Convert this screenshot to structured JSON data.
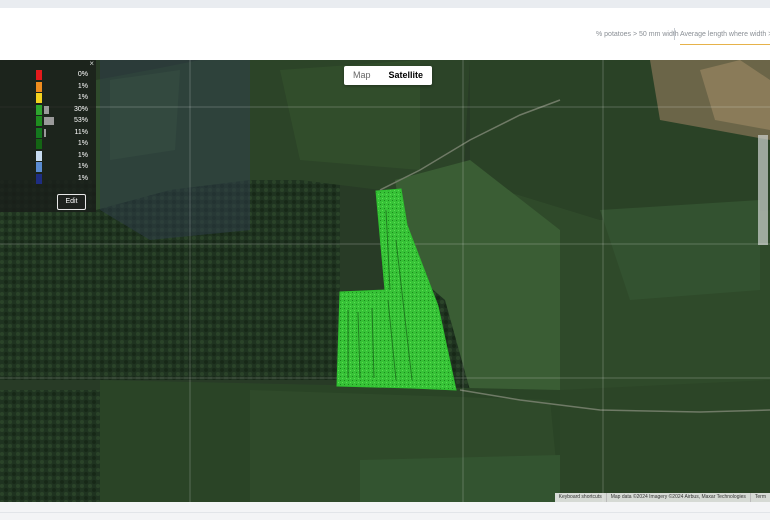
{
  "header": {
    "tabs": [
      {
        "label": "% potatoes > 50 mm width"
      },
      {
        "label": "Average length where width > 50 m"
      }
    ]
  },
  "map": {
    "type_control": {
      "map_label": "Map",
      "satellite_label": "Satellite",
      "selected": "Satellite"
    },
    "legend": {
      "close_symbol": "×",
      "rows": [
        {
          "color": "#e31a1c",
          "pct": "0%",
          "share": 0
        },
        {
          "color": "#f08c1e",
          "pct": "1%",
          "share": 1
        },
        {
          "color": "#f5d21e",
          "pct": "1%",
          "share": 1
        },
        {
          "color": "#2ea62e",
          "pct": "30%",
          "share": 30
        },
        {
          "color": "#1e8c1e",
          "pct": "53%",
          "share": 53
        },
        {
          "color": "#14781e",
          "pct": "11%",
          "share": 11
        },
        {
          "color": "#146414",
          "pct": "1%",
          "share": 1
        },
        {
          "color": "#c8dcf0",
          "pct": "1%",
          "share": 1
        },
        {
          "color": "#5a8cd2",
          "pct": "1%",
          "share": 1
        },
        {
          "color": "#1e2d82",
          "pct": "1%",
          "share": 1
        }
      ],
      "edit_label": "Edit"
    },
    "attribution": {
      "keyboard": "Keyboard shortcuts",
      "data": "Map data ©2024 Imagery ©2024 Airbus, Maxar Technologies",
      "terms": "Term"
    }
  }
}
